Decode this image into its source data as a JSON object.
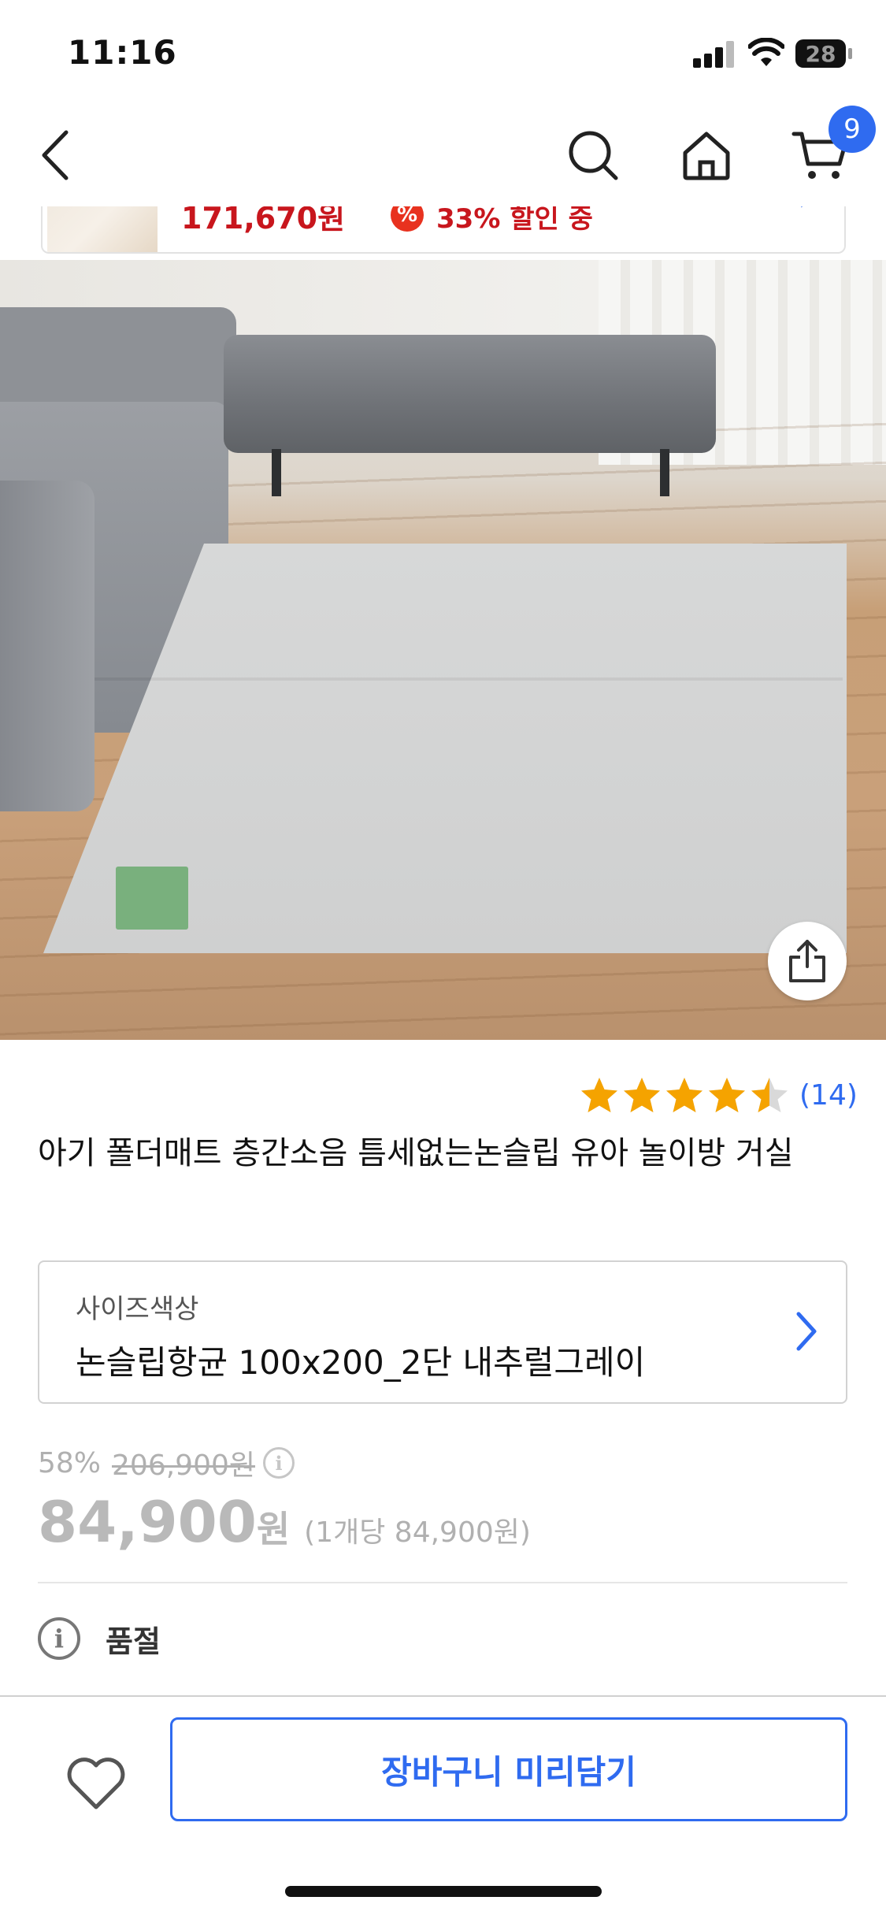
{
  "status_bar": {
    "time": "11:16",
    "battery": "28"
  },
  "nav": {
    "cart_count": "9"
  },
  "promo": {
    "price": "171,670원",
    "pct_icon": "%",
    "text": "33% 할인 중"
  },
  "rating": {
    "stars": 4.5,
    "count": "(14)"
  },
  "product": {
    "title": "아기 폴더매트 층간소음 틈세없는논슬립 유아 놀이방 거실"
  },
  "option": {
    "label": "사이즈색상",
    "value": "논슬립항균 100x200_2단 내추럴그레이"
  },
  "price": {
    "discount": "58%",
    "original": "206,900원",
    "sale": "84,900",
    "currency": "원",
    "unit_price": "(1개당 84,900원)"
  },
  "stock": {
    "status": "품절"
  },
  "actions": {
    "cart_button": "장바구니 미리담기"
  },
  "colors": {
    "accent": "#2f6bf0",
    "promo_red": "#c8161d",
    "star": "#f5a300"
  },
  "icons": [
    "back-icon",
    "search-icon",
    "home-icon",
    "cart-icon",
    "share-icon",
    "star-icon",
    "chevron-right-icon",
    "info-icon",
    "heart-icon"
  ]
}
